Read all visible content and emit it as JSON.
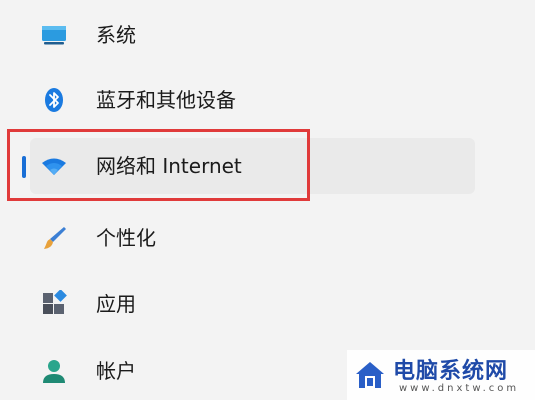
{
  "nav": {
    "items": [
      {
        "label": "系统",
        "icon": "monitor-icon"
      },
      {
        "label": "蓝牙和其他设备",
        "icon": "bluetooth-icon"
      },
      {
        "label": "网络和 Internet",
        "icon": "wifi-icon",
        "selected": true
      },
      {
        "label": "个性化",
        "icon": "brush-icon"
      },
      {
        "label": "应用",
        "icon": "apps-icon"
      },
      {
        "label": "帐户",
        "icon": "person-icon"
      }
    ]
  },
  "watermark": {
    "title": "电脑系统网",
    "url": "www.dnxtw.com"
  },
  "colors": {
    "accent": "#1a6fd6",
    "highlight_box": "#e03a3a",
    "selected_bg": "#eaeaea",
    "page_bg": "#f3f3f3"
  }
}
